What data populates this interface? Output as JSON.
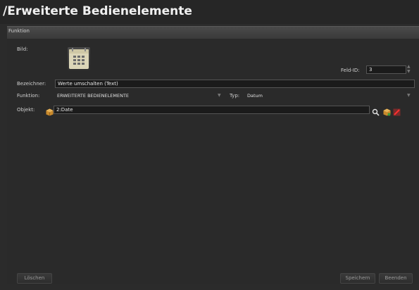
{
  "header": {
    "title": "/Erweiterte Bedienelemente"
  },
  "section": {
    "label": "Funktion"
  },
  "form": {
    "bild_label": "Bild:",
    "feld_id_label": "Feld-ID:",
    "feld_id_value": "3",
    "bezeichner_label": "Bezeichner:",
    "bezeichner_value": "Werte umschalten (Text)",
    "funktion_label": "Funktion:",
    "funktion_value": "ERWEITERTE BEDIENELEMENTE",
    "typ_label": "Typ:",
    "typ_value": "Datum",
    "objekt_label": "Objekt:",
    "objekt_value": "2:Date"
  },
  "footer": {
    "loeschen_label": "Löschen",
    "speichern_label": "Speichern",
    "beenden_label": "Beenden"
  },
  "icons": {
    "calendar": "calendar-icon",
    "package": "package-icon",
    "search": "search-icon",
    "remove": "remove-icon"
  }
}
